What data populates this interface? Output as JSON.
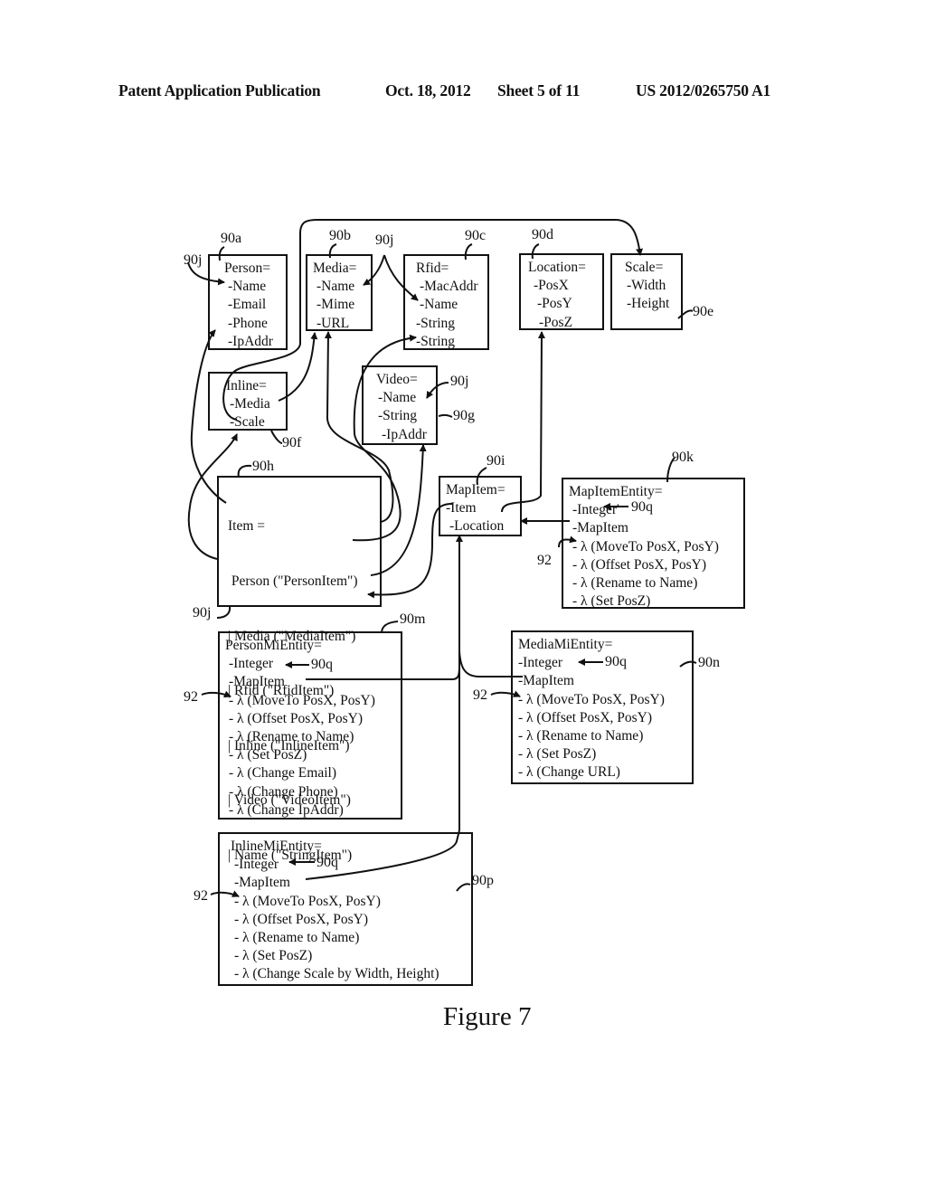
{
  "header": {
    "publication": "Patent Application Publication",
    "date": "Oct. 18, 2012",
    "sheet": "Sheet 5 of 11",
    "number": "US 2012/0265750 A1"
  },
  "figure_caption": "Figure 7",
  "boxes": {
    "person": {
      "ref": "90a",
      "lines": [
        "Person=",
        "-Name",
        "-Email",
        "-Phone",
        "-IpAddr"
      ]
    },
    "media": {
      "ref": "90b",
      "lines": [
        "Media=",
        "-Name",
        "-Mime",
        "-URL"
      ]
    },
    "rfid": {
      "ref": "90c",
      "lines": [
        "Rfid=",
        "-MacAddr",
        "-Name",
        "-String",
        "-String"
      ]
    },
    "location": {
      "ref": "90d",
      "lines": [
        "Location=",
        "-PosX",
        "-PosY",
        "-PosZ"
      ]
    },
    "scale": {
      "ref": "90e",
      "lines": [
        "Scale=",
        "-Width",
        "-Height"
      ]
    },
    "inline": {
      "ref": "90f",
      "lines": [
        "Inline=",
        "-Media",
        "-Scale"
      ]
    },
    "video": {
      "ref": "90g",
      "lines": [
        "Video=",
        "-Name",
        "-String",
        "-IpAddr"
      ]
    },
    "item": {
      "ref": "90h",
      "lines": [
        "Item =",
        " Person (\"PersonItem\")",
        "| Media (\"MediaItem\")",
        "| Rfid (\"RfidItem\")",
        "| Inline (\"InlineItem\")",
        "| Video (\"VideoItem\")",
        "| Name (\"StringItem\")"
      ]
    },
    "mapitem": {
      "ref": "90i",
      "lines": [
        "MapItem=",
        "-Item",
        "-Location"
      ]
    },
    "mapitementity": {
      "ref": "90k",
      "lines": [
        "MapItemEntity=",
        "-Integer'",
        "-MapItem",
        "- λ (MoveTo PosX, PosY)",
        "- λ (Offset PosX, PosY)",
        "- λ (Rename to Name)",
        "- λ (Set PosZ)"
      ]
    },
    "personmientity": {
      "ref": "90m",
      "lines": [
        "PersonMiEntity=",
        "-Integer",
        "-MapItem",
        "- λ (MoveTo PosX, PosY)",
        "- λ (Offset PosX, PosY)",
        "- λ (Rename to Name)",
        "- λ (Set PosZ)",
        "- λ (Change Email)",
        "- λ (Change Phone)",
        "- λ (Change IpAddr)"
      ]
    },
    "mediamientity": {
      "ref": "90n",
      "lines": [
        "MediaMiEntity=",
        "-Integer",
        "-MapItem",
        "- λ (MoveTo PosX, PosY)",
        "- λ (Offset PosX, PosY)",
        "- λ (Rename to Name)",
        "- λ (Set PosZ)",
        "- λ (Change URL)"
      ]
    },
    "inlinemientity": {
      "ref": "90p",
      "lines": [
        "InlineMiEntity=",
        "-Integer",
        "-MapItem",
        "- λ (MoveTo PosX, PosY)",
        "- λ (Offset PosX, PosY)",
        "- λ (Rename to Name)",
        "- λ (Set PosZ)",
        "- λ (Change Scale by Width, Height)"
      ]
    }
  },
  "callouts": {
    "name_ref": "90j",
    "integer_ref": "90q",
    "lambda_ref": "92"
  }
}
